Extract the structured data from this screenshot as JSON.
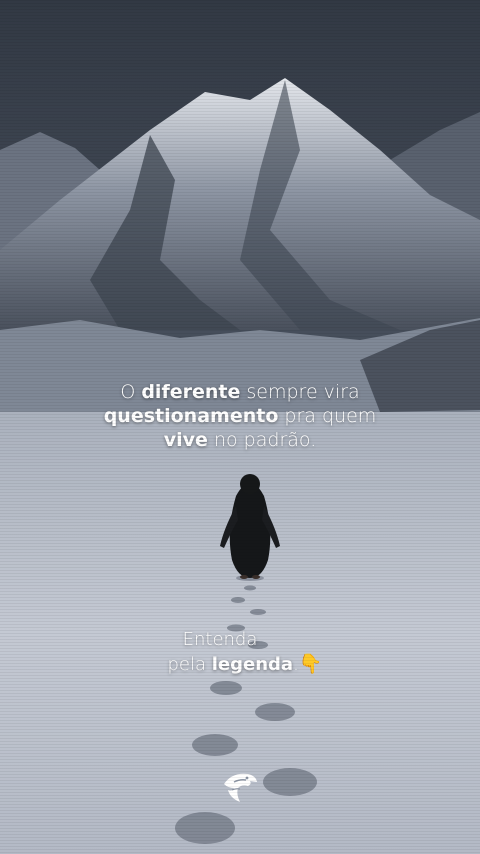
{
  "quote": {
    "w1": "O ",
    "w2": "diferente",
    "w3": " sempre vira",
    "w4": "questionamento",
    "w5": " pra quem",
    "w6": "vive",
    "w7": " no padrão."
  },
  "cta": {
    "line1": "Entenda",
    "w1": "pela ",
    "w2": "legenda",
    "w3": ".",
    "emoji_icon": "pointing-down-hand-icon"
  },
  "logo": {
    "icon": "eagle-head-icon",
    "color": "#ffffff"
  },
  "colors": {
    "sky": "#3f4652",
    "snow": "#c9ced8",
    "text": "#ffffff"
  }
}
